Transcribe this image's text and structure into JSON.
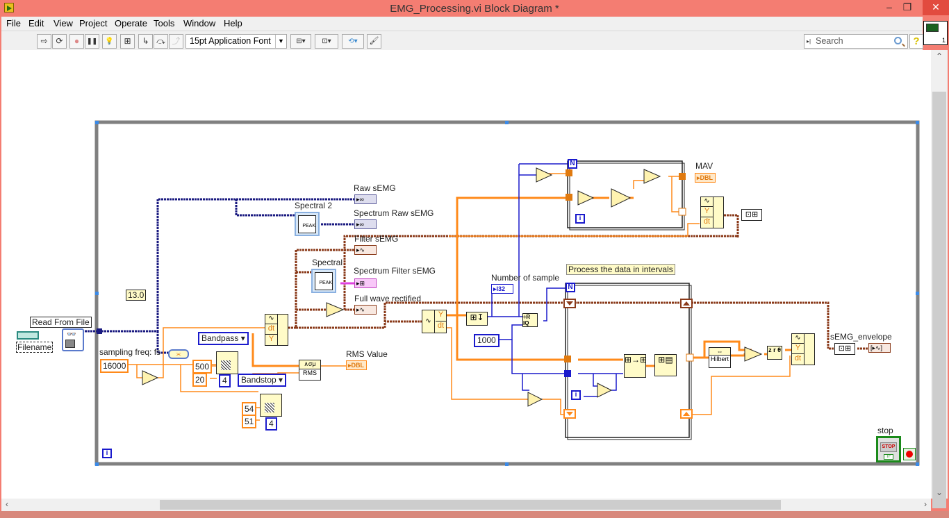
{
  "window": {
    "title": "EMG_Processing.vi Block Diagram *",
    "controls": {
      "minimize": "–",
      "maximize": "❐",
      "close": "✕"
    }
  },
  "menu": [
    "File",
    "Edit",
    "View",
    "Project",
    "Operate",
    "Tools",
    "Window",
    "Help"
  ],
  "toolbar": {
    "buttons": [
      {
        "name": "run-icon",
        "glyph": "⇨"
      },
      {
        "name": "run-continuously-icon",
        "glyph": "⟳"
      },
      {
        "name": "abort-icon",
        "glyph": "●"
      },
      {
        "name": "pause-icon",
        "glyph": "❚❚"
      },
      {
        "name": "highlight-execution-icon",
        "glyph": "💡"
      },
      {
        "name": "retain-wire-values-icon",
        "glyph": "⊞"
      },
      {
        "name": "step-into-icon",
        "glyph": "↳"
      },
      {
        "name": "step-over-icon",
        "glyph": "⤼"
      },
      {
        "name": "step-out-icon",
        "glyph": "⤴"
      }
    ],
    "font_select": "15pt Application Font",
    "align_buttons": [
      {
        "name": "align-objects-icon",
        "glyph": "⊟▾"
      },
      {
        "name": "distribute-objects-icon",
        "glyph": "⊡▾"
      },
      {
        "name": "reorder-icon",
        "glyph": "⟲▾"
      },
      {
        "name": "cleanup-diagram-icon",
        "glyph": "🖌"
      }
    ],
    "search_placeholder": "Search",
    "help_label": "?"
  },
  "vi_icon": {
    "number": "1"
  },
  "diagram": {
    "read_from_file": "Read From File",
    "filename": "Filename",
    "constant_13": "13.0",
    "sampling_label": "sampling freq: fs",
    "sampling_value": "16000",
    "bandpass": "Bandpass",
    "bandstop": "Bandstop",
    "high_cutoff": "500",
    "low_cutoff": "20",
    "bp_order": "4",
    "bs_high": "54",
    "bs_low": "51",
    "bs_order": "4",
    "raw_semg": "Raw sEMG",
    "spectral2": "Spectral 2",
    "spectrum_raw": "Spectrum Raw sEMG",
    "filter_semg": "Filter sEMG",
    "spectral": "Spectral",
    "spectrum_filter": "Spectrum Filter sEMG",
    "full_wave": "Full wave rectified",
    "rms_value": "RMS Value",
    "rms_node": "RMS",
    "mav": "MAV",
    "dbl": "DBL",
    "i32": "I32",
    "number_of_sample": "Number of sample",
    "const_1000": "1000",
    "process_comment": "Process the data in intervals",
    "hilbert": "Hilbert",
    "semg_envelope": "sEMG_envelope",
    "stop": "stop",
    "stop_btn": "STOP",
    "tf": "TF",
    "loop_n": "N",
    "loop_i": "i",
    "peak": "PEAK",
    "dt": "dt",
    "y": "Y"
  }
}
